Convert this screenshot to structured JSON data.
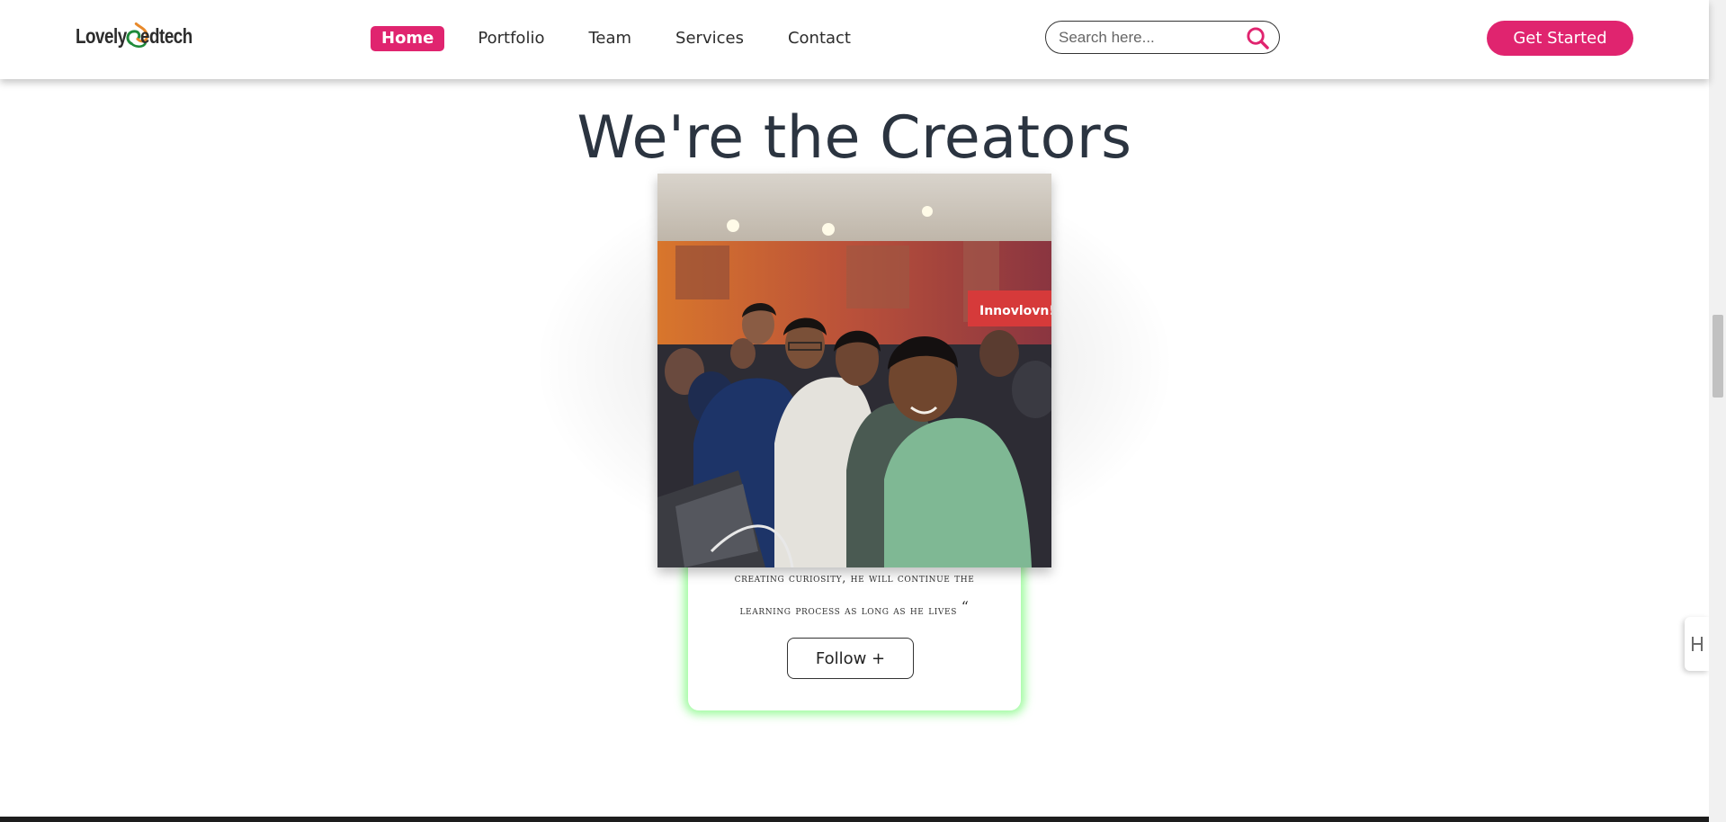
{
  "header": {
    "logo": {
      "text_left": "Lovely",
      "text_right": "edtech"
    },
    "nav": [
      {
        "label": "Home",
        "active": true
      },
      {
        "label": "Portfolio",
        "active": false
      },
      {
        "label": "Team",
        "active": false
      },
      {
        "label": "Services",
        "active": false
      },
      {
        "label": "Contact",
        "active": false
      }
    ],
    "search": {
      "placeholder": "Search here...",
      "value": "",
      "icon": "search-icon"
    },
    "cta_label": "Get Started"
  },
  "main": {
    "title": "We're the Creators",
    "card": {
      "quote_line_1": "creating curiosity, he will continue the",
      "quote_line_2": "learning process as long as he lives",
      "quote_mark": "“",
      "follow_label": "Follow +"
    }
  },
  "colors": {
    "accent": "#e0246f",
    "title": "#2b3440",
    "glow": "#82fa82"
  }
}
